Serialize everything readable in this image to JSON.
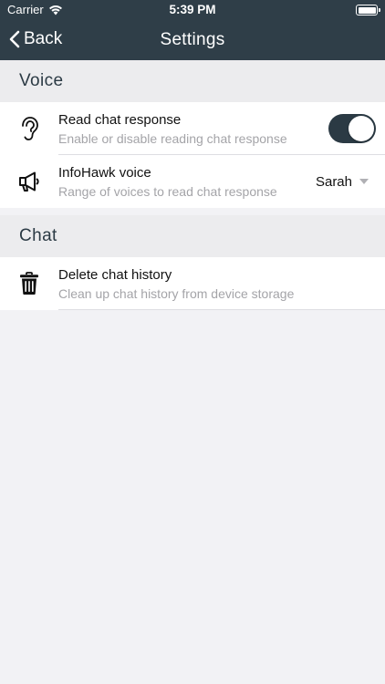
{
  "status": {
    "carrier": "Carrier",
    "time": "5:39 PM"
  },
  "nav": {
    "back_label": "Back",
    "title": "Settings"
  },
  "sections": [
    {
      "title": "Voice"
    },
    {
      "title": "Chat"
    }
  ],
  "rows": {
    "read_chat": {
      "title": "Read chat response",
      "subtitle": "Enable or disable reading chat response",
      "toggle_on": true,
      "icon": "ear-icon"
    },
    "voice": {
      "title": "InfoHawk voice",
      "subtitle": "Range of voices to read chat response",
      "selected": "Sarah",
      "icon": "megaphone-icon"
    },
    "delete": {
      "title": "Delete chat history",
      "subtitle": "Clean up chat history from device storage",
      "icon": "trash-icon"
    }
  },
  "colors": {
    "nav_bg": "#2f3e48",
    "accent": "#2b3a44",
    "background": "#f2f2f5"
  }
}
